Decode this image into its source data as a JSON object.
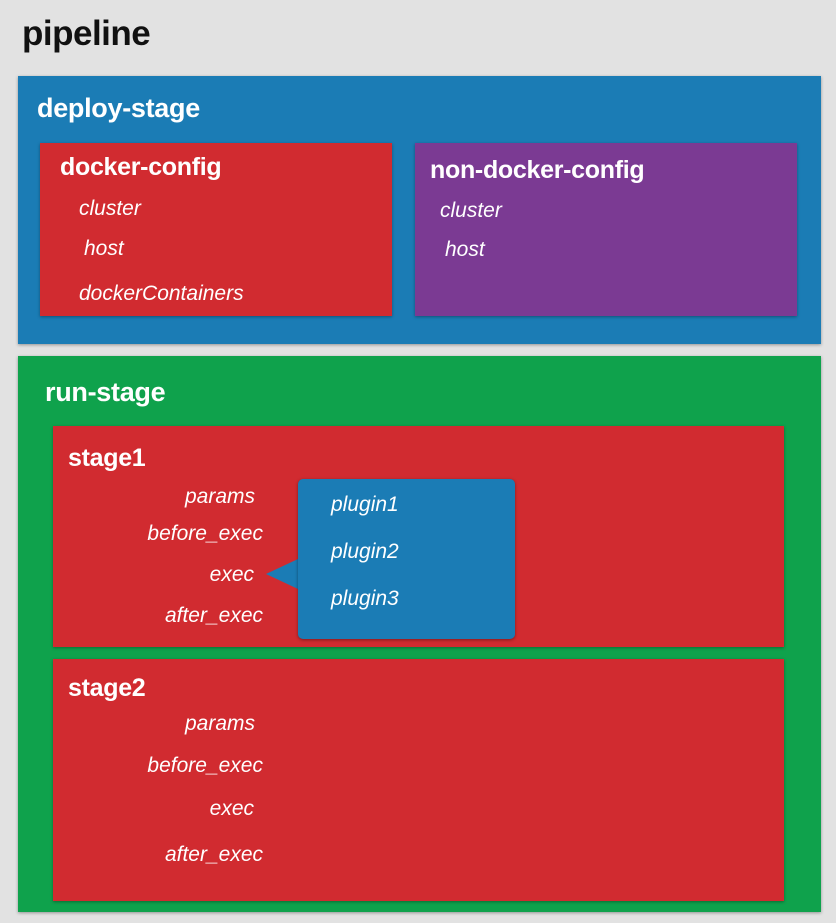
{
  "title": "pipeline",
  "deploy_stage": {
    "title": "deploy-stage",
    "docker_config": {
      "title": "docker-config",
      "fields": [
        "cluster",
        "host",
        "dockerContainers"
      ]
    },
    "non_docker_config": {
      "title": "non-docker-config",
      "fields": [
        "cluster",
        "host"
      ]
    }
  },
  "run_stage": {
    "title": "run-stage",
    "stage1": {
      "title": "stage1",
      "fields": [
        "params",
        "before_exec",
        "exec",
        "after_exec"
      ],
      "plugins": [
        "plugin1",
        "plugin2",
        "plugin3"
      ]
    },
    "stage2": {
      "title": "stage2",
      "fields": [
        "params",
        "before_exec",
        "exec",
        "after_exec"
      ]
    }
  },
  "colors": {
    "background": "#e2e2e2",
    "deploy_stage": "#1b7cb5",
    "run_stage": "#0fa24c",
    "docker_config": "#d12b30",
    "non_docker_config": "#7b3a93",
    "stage": "#d12b30",
    "plugin_callout": "#1b7cb5"
  }
}
